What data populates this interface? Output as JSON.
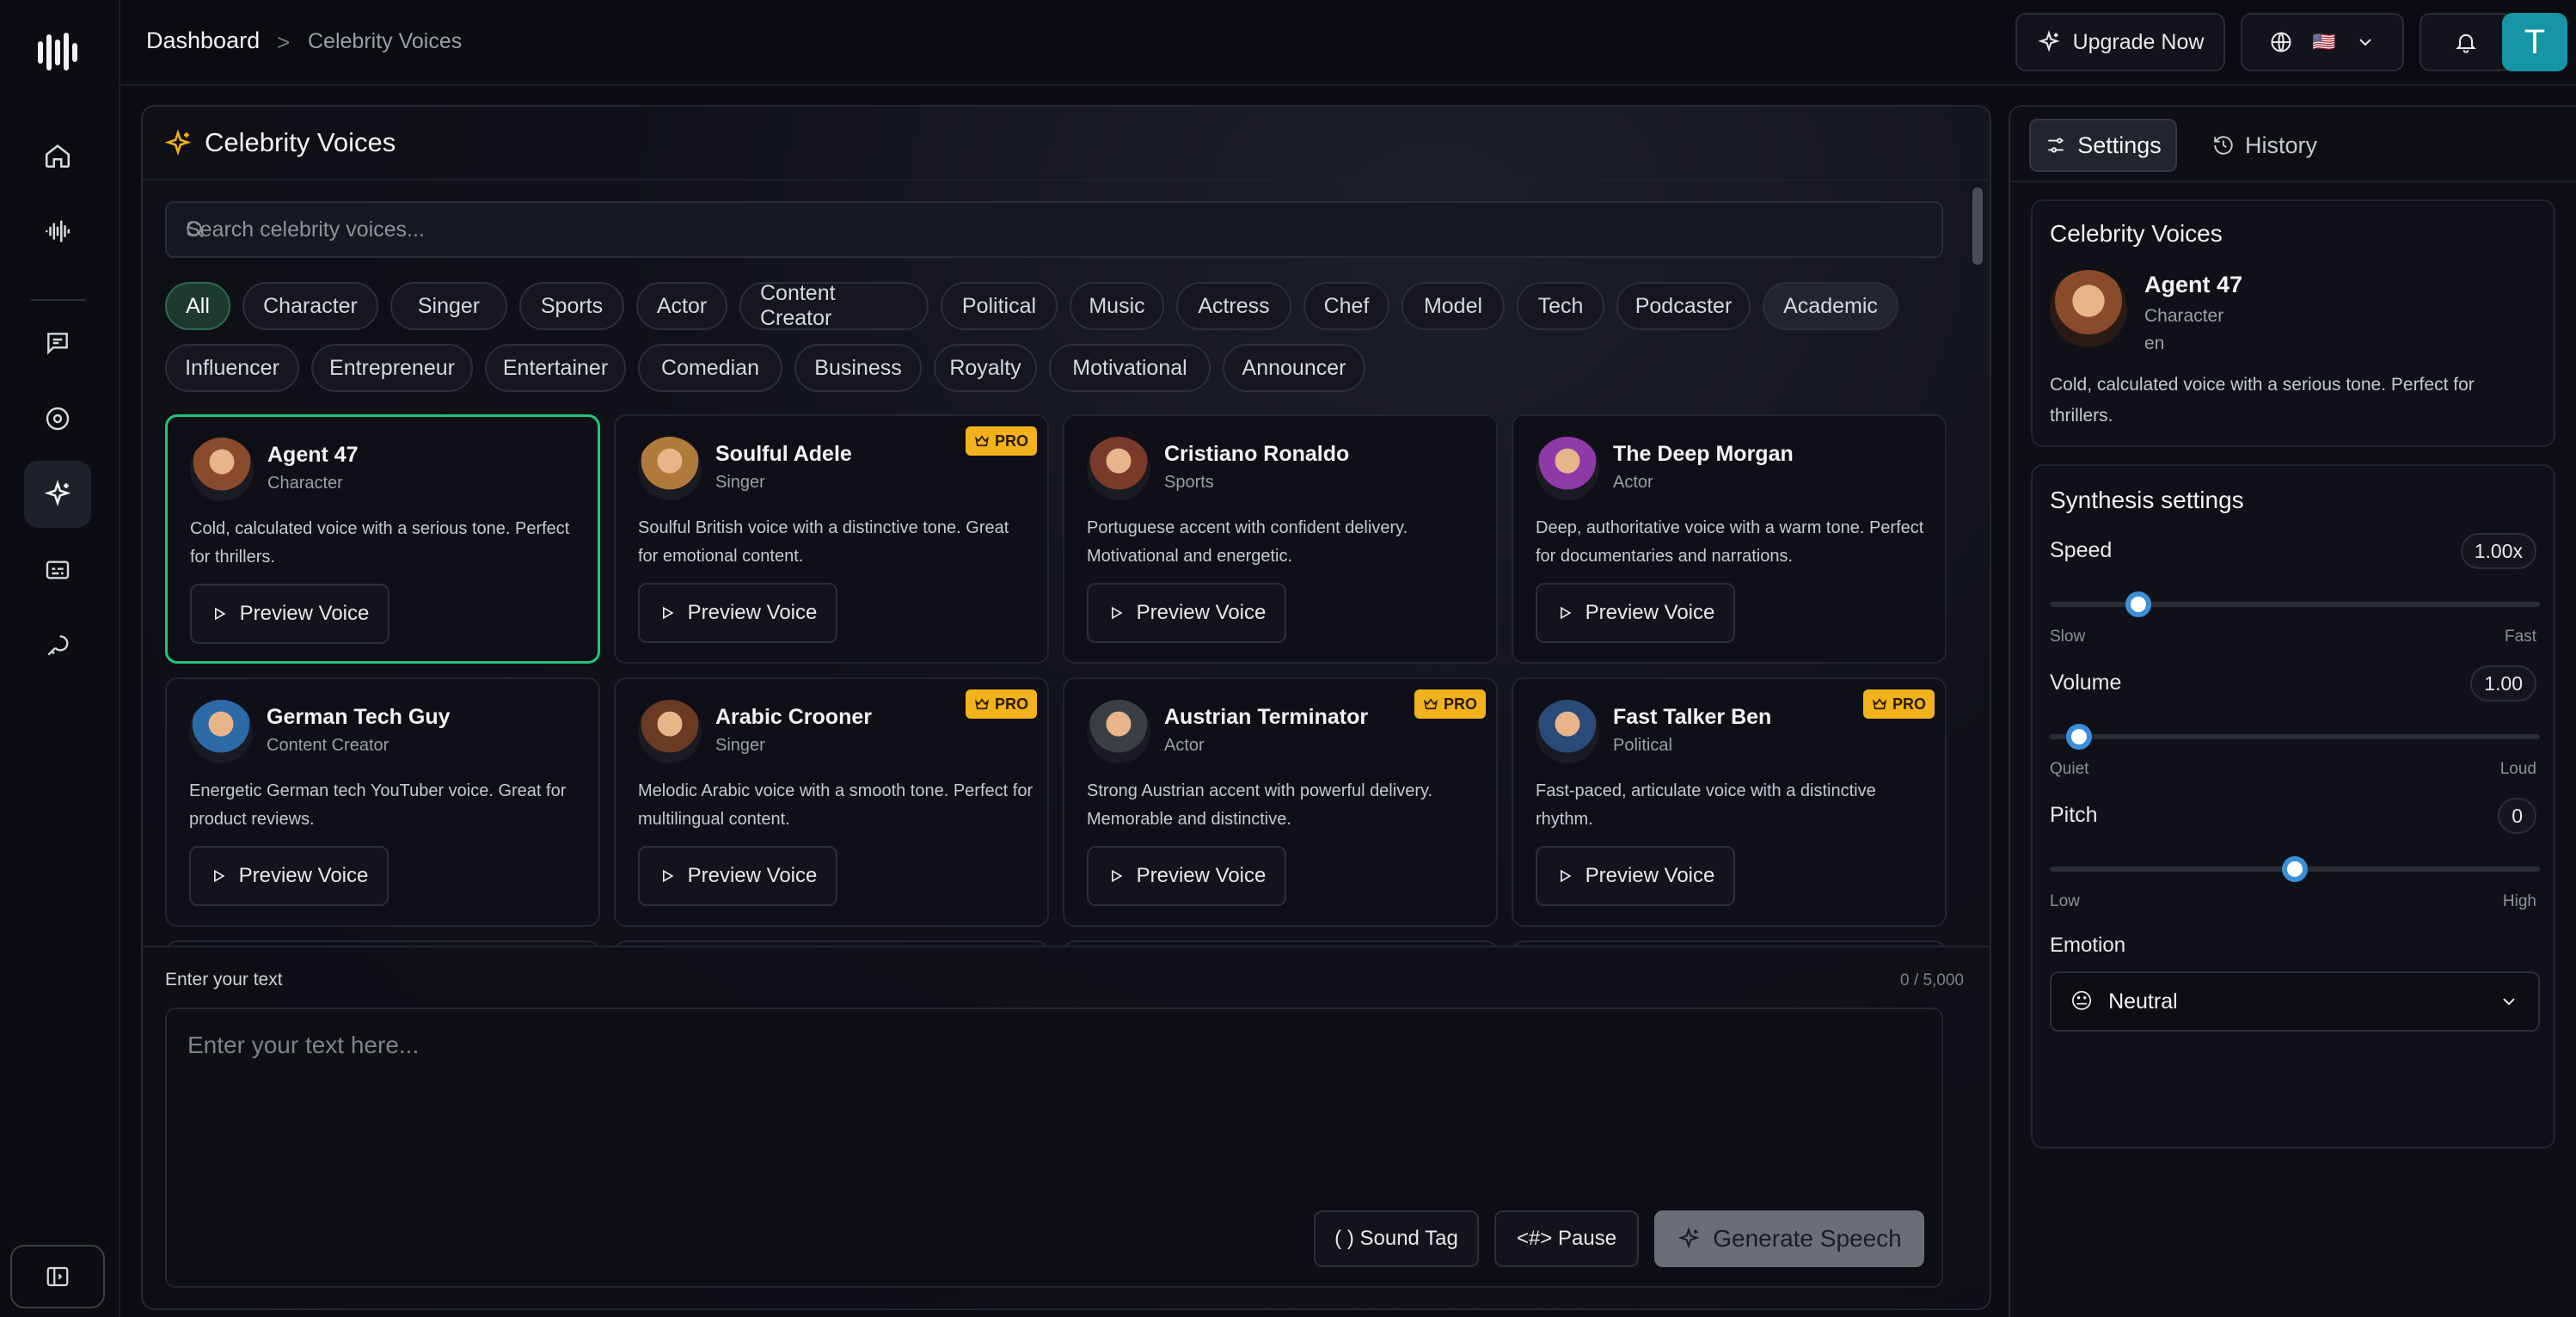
{
  "breadcrumb": {
    "home": "Dashboard",
    "separator": ">",
    "current": "Celebrity Voices"
  },
  "topbar": {
    "upgrade_label": "Upgrade Now",
    "flag": "🇺🇸",
    "avatar_letter": "T"
  },
  "sidebar": {
    "items": [
      {
        "icon": "home-icon"
      },
      {
        "icon": "waveform-icon"
      },
      {
        "icon": "chat-icon"
      },
      {
        "icon": "disc-icon"
      },
      {
        "icon": "sparkle-icon",
        "active": true
      },
      {
        "icon": "subtitles-icon"
      },
      {
        "icon": "key-icon"
      }
    ]
  },
  "main": {
    "title": "Celebrity Voices",
    "search_placeholder": "Search celebrity voices...",
    "categories_row1": [
      "All",
      "Character",
      "Singer",
      "Sports",
      "Actor",
      "Content Creator",
      "Political",
      "Music",
      "Actress",
      "Chef",
      "Model",
      "Tech",
      "Podcaster",
      "Academic"
    ],
    "categories_row2": [
      "Influencer",
      "Entrepreneur",
      "Entertainer",
      "Comedian",
      "Business",
      "Royalty",
      "Motivational",
      "Announcer"
    ],
    "preview_label": "Preview Voice",
    "pro_label": "PRO",
    "voices": [
      {
        "name": "Agent 47",
        "category": "Character",
        "description": "Cold, calculated voice with a serious tone. Perfect for thrillers.",
        "pro": false,
        "selected": true,
        "color": "#8a4b2c"
      },
      {
        "name": "Soulful Adele",
        "category": "Singer",
        "description": "Soulful British voice with a distinctive tone. Great for emotional content.",
        "pro": true,
        "selected": false,
        "color": "#b07a3a"
      },
      {
        "name": "Cristiano Ronaldo",
        "category": "Sports",
        "description": "Portuguese accent with confident delivery. Motivational and energetic.",
        "pro": false,
        "selected": false,
        "color": "#7a3a2a"
      },
      {
        "name": "The Deep Morgan",
        "category": "Actor",
        "description": "Deep, authoritative voice with a warm tone. Perfect for documentaries and narrations.",
        "pro": false,
        "selected": false,
        "color": "#8e3aa8"
      },
      {
        "name": "German Tech Guy",
        "category": "Content Creator",
        "description": "Energetic German tech YouTuber voice. Great for product reviews.",
        "pro": false,
        "selected": false,
        "color": "#2d6aa8"
      },
      {
        "name": "Arabic Crooner",
        "category": "Singer",
        "description": "Melodic Arabic voice with a smooth tone. Perfect for multilingual content.",
        "pro": true,
        "selected": false,
        "color": "#6b3a22"
      },
      {
        "name": "Austrian Terminator",
        "category": "Actor",
        "description": "Strong Austrian accent with powerful delivery. Memorable and distinctive.",
        "pro": true,
        "selected": false,
        "color": "#3a3f44"
      },
      {
        "name": "Fast Talker Ben",
        "category": "Political",
        "description": "Fast-paced, articulate voice with a distinctive rhythm.",
        "pro": true,
        "selected": false,
        "color": "#2a4a7a"
      }
    ],
    "text_label": "Enter your text",
    "text_count": "0 / 5,000",
    "text_placeholder": "Enter your text here...",
    "sound_tag_label": "( ) Sound Tag",
    "pause_label": "<#> Pause",
    "generate_label": "Generate Speech"
  },
  "right": {
    "tabs": [
      {
        "label": "Settings",
        "active": true
      },
      {
        "label": "History",
        "active": false
      }
    ],
    "selected_voice": {
      "section_title": "Celebrity Voices",
      "name": "Agent 47",
      "category": "Character",
      "language": "en",
      "description": "Cold, calculated voice with a serious tone. Perfect for thrillers."
    },
    "synthesis": {
      "title": "Synthesis settings",
      "speed": {
        "label": "Speed",
        "value": "1.00x",
        "min_label": "Slow",
        "max_label": "Fast",
        "position": 0.18
      },
      "volume": {
        "label": "Volume",
        "value": "1.00",
        "min_label": "Quiet",
        "max_label": "Loud",
        "position": 0.06
      },
      "pitch": {
        "label": "Pitch",
        "value": "0",
        "min_label": "Low",
        "max_label": "High",
        "position": 0.5
      },
      "emotion_label": "Emotion",
      "emotion_value": "Neutral",
      "emotion_emoji": "😐"
    }
  }
}
